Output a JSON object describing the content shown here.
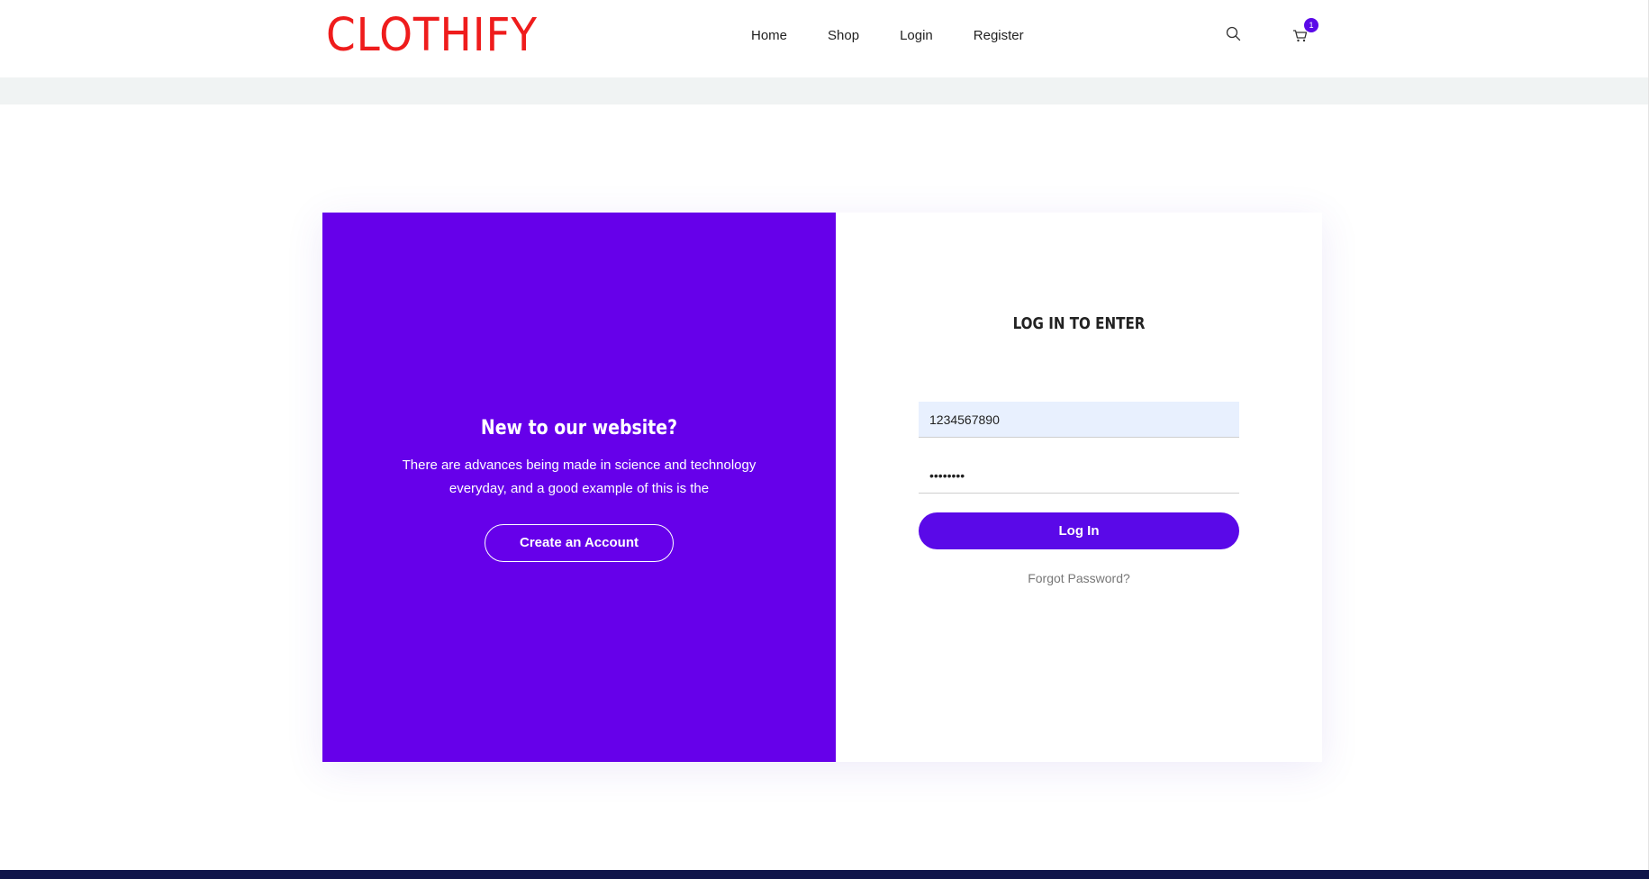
{
  "header": {
    "logo_text": "CLOTHIFY",
    "nav": [
      {
        "label": "Home"
      },
      {
        "label": "Shop"
      },
      {
        "label": "Login"
      },
      {
        "label": "Register"
      }
    ],
    "search_icon": "search-icon",
    "cart_icon": "cart-icon",
    "cart_count": "1"
  },
  "welcome": {
    "title": "New to our website?",
    "text": "There are advances being made in science and technology everyday, and a good example of this is the",
    "create_button": "Create an Account"
  },
  "login": {
    "title": "LOG IN TO ENTER",
    "username_value": "1234567890",
    "password_value": "••••••••",
    "submit_label": "Log In",
    "forgot_label": "Forgot Password?"
  },
  "colors": {
    "brand_red": "#ef1c1c",
    "accent_purple": "#6600ea",
    "button_purple": "#5a09e8",
    "footer_navy": "#10154a"
  }
}
